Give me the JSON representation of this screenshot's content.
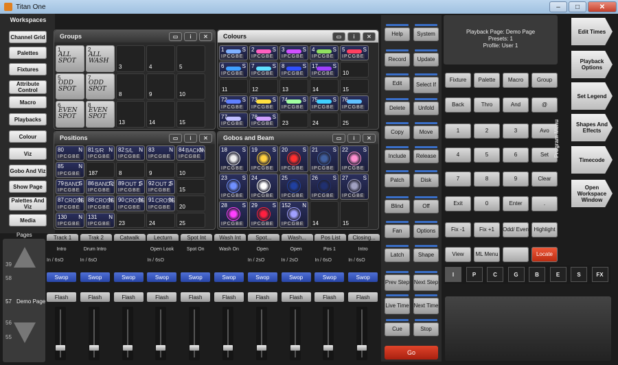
{
  "window": {
    "title": "Titan One",
    "min": "–",
    "max": "□",
    "close": "✕"
  },
  "sidebar": {
    "header": "Workspaces",
    "items": [
      "Channel Grid",
      "Palettes",
      "Fixtures",
      "Attribute Control",
      "Macro",
      "Playbacks",
      "Colour",
      "Viz",
      "Gobo And Viz",
      "Show Page",
      "Palettes And Viz",
      "Media"
    ],
    "pages_label": "Pages",
    "page_nums": [
      "39",
      "58",
      "57",
      "56",
      "55"
    ],
    "page_name": "Demo Page"
  },
  "groups": {
    "title": "Groups",
    "cells": [
      {
        "n": "1",
        "label": "ALL SPOT"
      },
      {
        "n": "2",
        "label": "ALL WASH"
      },
      {
        "n": "3",
        "label": ""
      },
      {
        "n": "4",
        "label": ""
      },
      {
        "n": "5",
        "label": ""
      },
      {
        "n": "5",
        "label": "ODD SPOT"
      },
      {
        "n": "7",
        "label": "ODD SPOT"
      },
      {
        "n": "8",
        "label": ""
      },
      {
        "n": "9",
        "label": ""
      },
      {
        "n": "10",
        "label": ""
      },
      {
        "n": "6",
        "label": "EVEN SPOT"
      },
      {
        "n": "8",
        "label": "EVEN SPOT"
      },
      {
        "n": "13",
        "label": ""
      },
      {
        "n": "14",
        "label": ""
      },
      {
        "n": "15",
        "label": ""
      }
    ]
  },
  "colours": {
    "title": "Colours",
    "cells": [
      {
        "n": "1",
        "s": "S"
      },
      {
        "n": "2",
        "s": "S"
      },
      {
        "n": "3",
        "s": "S"
      },
      {
        "n": "4",
        "s": "S"
      },
      {
        "n": "5",
        "s": "S"
      },
      {
        "n": "6",
        "s": "S"
      },
      {
        "n": "7",
        "s": "S"
      },
      {
        "n": "8",
        "s": "S"
      },
      {
        "n": "17",
        "s": "S"
      },
      {
        "n": "10",
        "s": ""
      },
      {
        "n": "11",
        "s": ""
      },
      {
        "n": "12",
        "s": ""
      },
      {
        "n": "13",
        "s": ""
      },
      {
        "n": "14",
        "s": ""
      },
      {
        "n": "15",
        "s": ""
      },
      {
        "n": "72",
        "s": "S"
      },
      {
        "n": "73",
        "s": "S"
      },
      {
        "n": "74",
        "s": "S"
      },
      {
        "n": "75",
        "s": "S"
      },
      {
        "n": "76",
        "s": ""
      },
      {
        "n": "77",
        "s": ""
      },
      {
        "n": "78",
        "s": "S"
      },
      {
        "n": "23",
        "s": ""
      },
      {
        "n": "24",
        "s": ""
      },
      {
        "n": "25",
        "s": ""
      }
    ],
    "swatches": [
      "#7fb0ff",
      "#ff60c0",
      "#d050ff",
      "#90e060",
      "#ff4060",
      "#40a0ff",
      "#60e0ff",
      "#3050ff",
      "#a040ff",
      "",
      "",
      "",
      "",
      "",
      "",
      "#6080ff",
      "#ffe040",
      "#a0ffa0",
      "#40d0ff",
      "#60c0ff",
      "#c0c0ff",
      "#d0a0ff",
      "",
      "",
      ""
    ]
  },
  "positions": {
    "title": "Positions",
    "cells": [
      {
        "n": "80",
        "t": "",
        "s": "N"
      },
      {
        "n": "81",
        "t": "S/R",
        "s": "N"
      },
      {
        "n": "82",
        "t": "S/L",
        "s": "N"
      },
      {
        "n": "83",
        "t": "",
        "s": "N"
      },
      {
        "n": "84",
        "t": "BACKING",
        "s": "N"
      },
      {
        "n": "85",
        "t": "",
        "s": "N"
      },
      {
        "n": "187",
        "t": "",
        "s": ""
      },
      {
        "n": "8",
        "t": "",
        "s": ""
      },
      {
        "n": "9",
        "t": "",
        "s": ""
      },
      {
        "n": "10",
        "t": "",
        "s": ""
      },
      {
        "n": "79",
        "t": "BAND",
        "s": "S"
      },
      {
        "n": "86",
        "t": "BAND 2",
        "s": "S"
      },
      {
        "n": "89",
        "t": "OUT 1",
        "s": "S"
      },
      {
        "n": "92",
        "t": "OUT 2",
        "s": "S"
      },
      {
        "n": "15",
        "t": "",
        "s": ""
      },
      {
        "n": "87",
        "t": "CROSS 1",
        "s": "N"
      },
      {
        "n": "88",
        "t": "CROSS 2",
        "s": "N"
      },
      {
        "n": "90",
        "t": "CROSS",
        "s": "N"
      },
      {
        "n": "91",
        "t": "CROSS",
        "s": "N"
      },
      {
        "n": "20",
        "t": "",
        "s": ""
      },
      {
        "n": "130",
        "t": "",
        "s": "N"
      },
      {
        "n": "131",
        "t": "",
        "s": "N"
      },
      {
        "n": "23",
        "t": "",
        "s": ""
      },
      {
        "n": "24",
        "t": "",
        "s": ""
      },
      {
        "n": "25",
        "t": "",
        "s": ""
      }
    ]
  },
  "gobos": {
    "title": "Gobos and Beam",
    "cells": [
      {
        "n": "18",
        "s": "S",
        "c": "#eeeeee"
      },
      {
        "n": "19",
        "s": "S",
        "c": "#ffd040"
      },
      {
        "n": "20",
        "s": "S",
        "c": "#ff3030"
      },
      {
        "n": "21",
        "s": "S",
        "c": "#4060a0"
      },
      {
        "n": "22",
        "s": "S",
        "c": "#ff90d0"
      },
      {
        "n": "23",
        "s": "S",
        "c": "#7090ff"
      },
      {
        "n": "24",
        "s": "",
        "c": "#ffffff"
      },
      {
        "n": "25",
        "s": "",
        "c": "#2040a0"
      },
      {
        "n": "26",
        "s": "S",
        "c": "#203070"
      },
      {
        "n": "27",
        "s": "S",
        "c": "#a0a0c0"
      },
      {
        "n": "28",
        "s": "S",
        "c": "#ff40ff"
      },
      {
        "n": "29",
        "s": "S",
        "c": "#ff2040"
      },
      {
        "n": "152",
        "s": "N",
        "c": "#a0a0ff"
      },
      {
        "n": "",
        "s": "",
        "c": ""
      },
      {
        "n": "",
        "s": "",
        "c": ""
      }
    ],
    "empty": [
      "14",
      "15"
    ]
  },
  "flags": "IPCGBE",
  "cmdbtns": [
    [
      "Help",
      "System"
    ],
    [
      "Record",
      "Update"
    ],
    [
      "Edit",
      "Select If"
    ],
    [
      "Delete",
      "Unfold"
    ],
    [
      "Copy",
      "Move"
    ],
    [
      "Include",
      "Release"
    ],
    [
      "Patch",
      "Disk"
    ],
    [
      "Blind",
      "Off"
    ],
    [
      "Fan",
      "Options"
    ],
    [
      "Latch",
      "Shape"
    ],
    [
      "Prev Step",
      "Next Step"
    ],
    [
      "Live Time",
      "Next Time"
    ],
    [
      "Cue",
      "Stop"
    ]
  ],
  "go_label": "Go",
  "info": {
    "line1": "Playback Page: Demo Page",
    "line2": "Presets: 1",
    "line3": "Profile: User 1"
  },
  "keypad": [
    [
      "Fixture",
      "Palette",
      "Macro",
      "Group"
    ],
    [
      "Back",
      "Thro",
      "And",
      "@"
    ],
    [
      "1",
      "2",
      "3",
      "Avo"
    ],
    [
      "4",
      "5",
      "6",
      "Set"
    ],
    [
      "7",
      "8",
      "9",
      "Clear"
    ],
    [
      "Exit",
      "0",
      "Enter",
      "."
    ],
    [
      "Fix -1",
      "Fix +1",
      "Odd/ Even",
      "Highlight"
    ],
    [
      "View",
      "ML Menu",
      "",
      "Locate"
    ]
  ],
  "program_menu": "Program Menu",
  "rightmenu": [
    "Edit Times",
    "Playback Options",
    "Set Legend",
    "Shapes And Effects",
    "Timecode",
    "Open Workspace Window"
  ],
  "filters": [
    "I",
    "P",
    "C",
    "G",
    "B",
    "E",
    "S",
    "FX"
  ],
  "playbacks": {
    "tabs": [
      "Track 1",
      "Trak 2",
      "Catwalk",
      "Lecturn",
      "Spot Int",
      "Wash Int",
      "Spot...",
      "Wash...",
      "Pos List",
      "Closing..."
    ],
    "names": [
      "Intro",
      "Drum Intro",
      "",
      "Open Look",
      "Spot On",
      "Wash On",
      "Open",
      "Open",
      "Pos 1",
      "Intro"
    ],
    "times": [
      "In / 6sO",
      "In / 6sO",
      "",
      "In / 6sO",
      "",
      "",
      "In / 2sO",
      "In / 2sO",
      "In / 6sO",
      "In / 6sO"
    ],
    "swop": "Swop",
    "flash": "Flash"
  },
  "colors": {
    "accent": "#3a6fc9",
    "go": "#c8301c",
    "locate": "#d84020"
  }
}
